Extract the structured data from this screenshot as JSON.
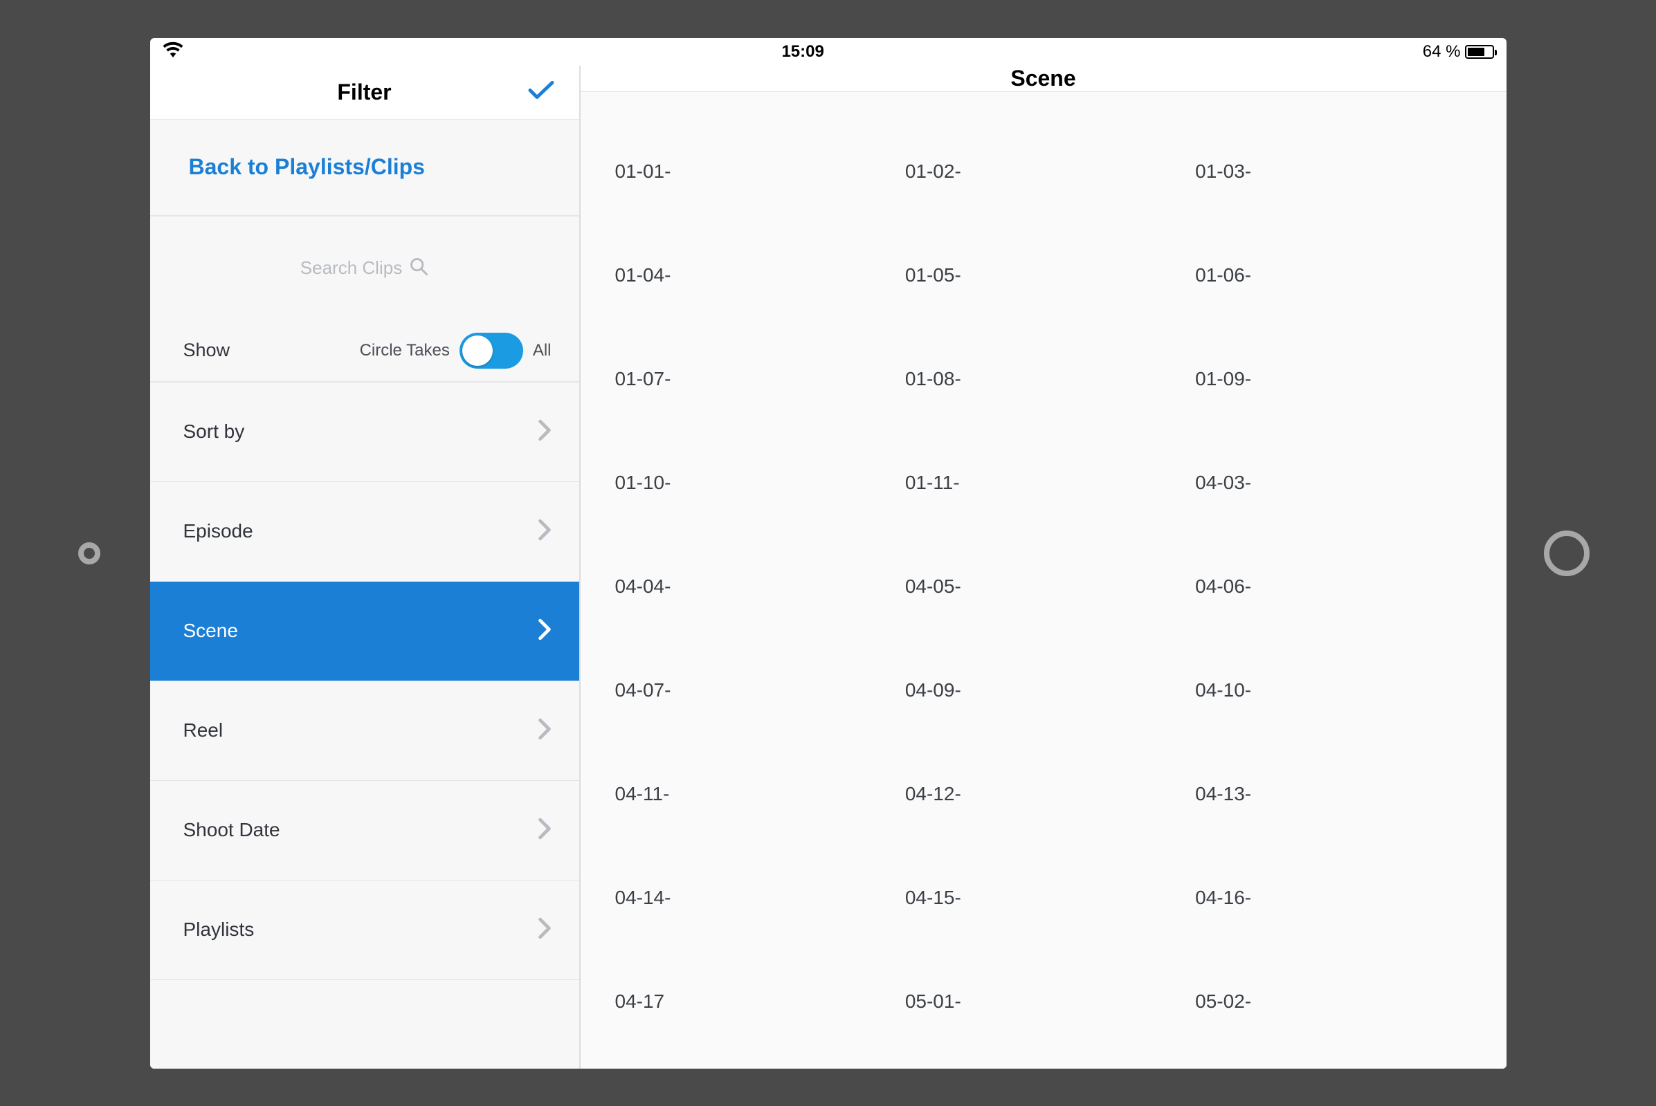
{
  "status_bar": {
    "time": "15:09",
    "battery_text": "64 %"
  },
  "sidebar": {
    "title": "Filter",
    "back_label": "Back to Playlists/Clips",
    "search_placeholder": "Search Clips",
    "show_label": "Show",
    "toggle_left_label": "Circle Takes",
    "toggle_right_label": "All",
    "filters": [
      {
        "label": "Sort by",
        "selected": false
      },
      {
        "label": "Episode",
        "selected": false
      },
      {
        "label": "Scene",
        "selected": true
      },
      {
        "label": "Reel",
        "selected": false
      },
      {
        "label": "Shoot Date",
        "selected": false
      },
      {
        "label": "Playlists",
        "selected": false
      }
    ]
  },
  "main": {
    "title": "Scene",
    "scenes": [
      "01-01-",
      "01-02-",
      "01-03-",
      "01-04-",
      "01-05-",
      "01-06-",
      "01-07-",
      "01-08-",
      "01-09-",
      "01-10-",
      "01-11-",
      "04-03-",
      "04-04-",
      "04-05-",
      "04-06-",
      "04-07-",
      "04-09-",
      "04-10-",
      "04-11-",
      "04-12-",
      "04-13-",
      "04-14-",
      "04-15-",
      "04-16-",
      "04-17",
      "05-01-",
      "05-02-"
    ]
  }
}
